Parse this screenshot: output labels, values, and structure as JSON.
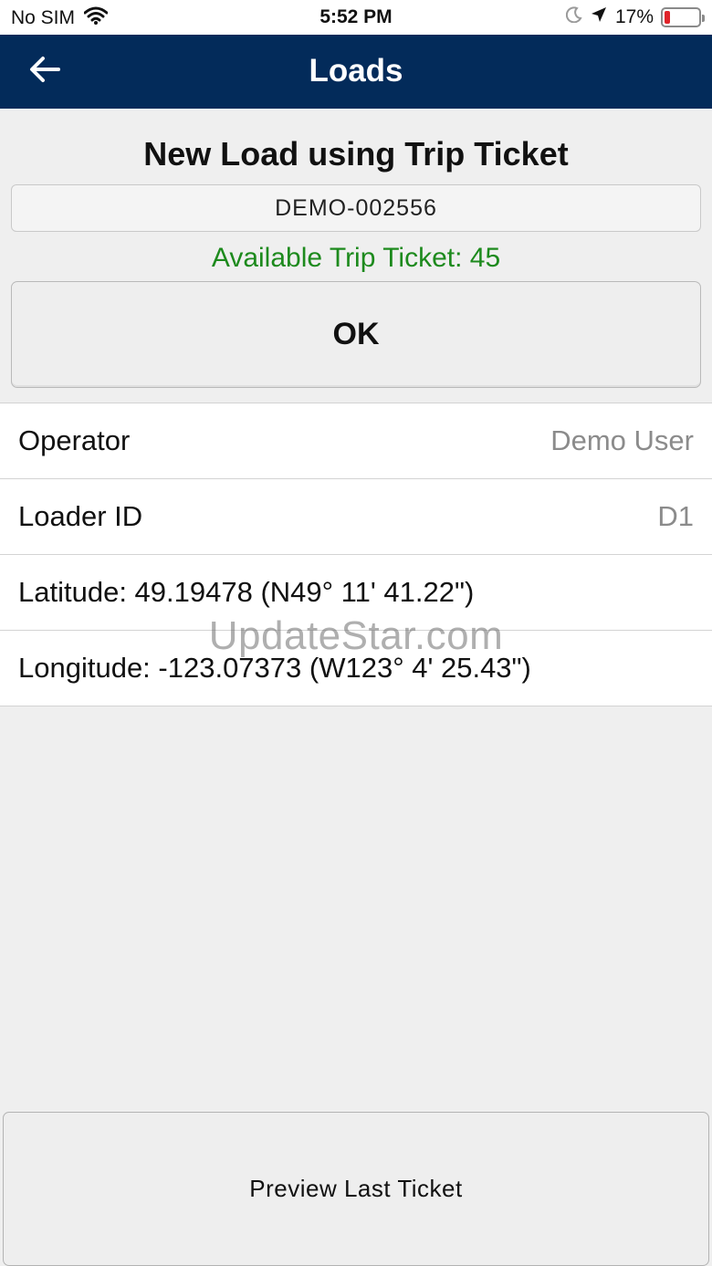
{
  "status_bar": {
    "carrier": "No SIM",
    "time": "5:52 PM",
    "battery_percent": "17%",
    "battery_level": 0.17,
    "icons": [
      "wifi-icon",
      "moon-icon",
      "location-arrow-icon",
      "battery-icon"
    ],
    "battery_color": "#e0242a"
  },
  "nav": {
    "title": "Loads",
    "back_icon": "arrow-left-icon",
    "background": "#032b5a"
  },
  "form": {
    "title": "New Load using Trip Ticket",
    "ticket_value": "DEMO-002556",
    "available_text": "Available Trip Ticket: 45",
    "available_color": "#1d8a1d",
    "ok_label": "OK"
  },
  "details": {
    "operator_label": "Operator",
    "operator_value": "Demo User",
    "loader_label": "Loader ID",
    "loader_value": "D1",
    "latitude_text": "Latitude: 49.19478 (N49° 11' 41.22\")",
    "longitude_text": "Longitude: -123.07373 (W123° 4' 25.43\")"
  },
  "watermark": "UpdateStar.com",
  "footer": {
    "preview_label": "Preview Last Ticket"
  }
}
